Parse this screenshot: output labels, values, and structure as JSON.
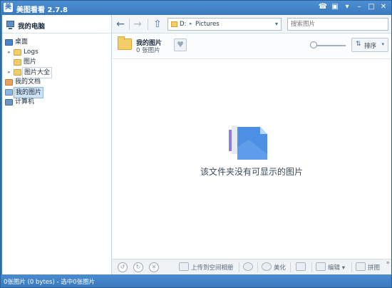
{
  "app": {
    "logo_char": "美",
    "title": "美图看看  2.7.8"
  },
  "window_controls": [
    {
      "name": "chat-icon",
      "glyph": "☎"
    },
    {
      "name": "skin-icon",
      "glyph": "▣"
    },
    {
      "name": "menu-icon",
      "glyph": "▾"
    },
    {
      "name": "minimize-icon",
      "glyph": "–"
    },
    {
      "name": "maximize-icon",
      "glyph": "□"
    },
    {
      "name": "close-icon",
      "glyph": "✕"
    }
  ],
  "sidebar": {
    "header": "我的电脑",
    "items": [
      {
        "label": "桌面",
        "level": 0,
        "icon": "desktop-icon",
        "expanded": true
      },
      {
        "label": "Logs",
        "level": 1,
        "icon": "folder-icon",
        "toggle": "▸"
      },
      {
        "label": "图片",
        "level": 1,
        "icon": "folder-icon",
        "toggle": ""
      },
      {
        "label": "图片大全",
        "level": 1,
        "icon": "folder-icon",
        "toggle": "▸"
      },
      {
        "label": "我的文档",
        "level": 0,
        "icon": "documents-icon"
      },
      {
        "label": "我的图片",
        "level": 0,
        "icon": "pictures-icon",
        "selected": true
      },
      {
        "label": "计算机",
        "level": 0,
        "icon": "computer-icon"
      }
    ]
  },
  "toolbar": {
    "back_glyph": "←",
    "forward_glyph": "→",
    "up_glyph": "⇧",
    "path_drive": "D:",
    "path_arrow": "▸",
    "path_segment": "Pictures",
    "path_dropdown": "▾",
    "search_placeholder": "搜索图片"
  },
  "folder_info": {
    "name": "我的图片",
    "count": "0 张图片",
    "fav_glyph": "♥",
    "zoom_level": 0.1,
    "sort_icon": "⇅",
    "sort_label": "排序",
    "sort_dropdown": "▾"
  },
  "empty_state": {
    "message": "该文件夹没有可显示的图片"
  },
  "bottom_toolbar": {
    "rotate_left": "↺",
    "rotate_right": "↻",
    "delete": "✕",
    "upload_label": "上传到空间相册",
    "beautify_label": "美化",
    "edit_label": "编辑",
    "edit_dropdown": "▾",
    "puzzle_label": "拼图",
    "more_glyph": "»"
  },
  "status": {
    "text": "0张图片 (0 bytes) - 选中0张图片"
  }
}
